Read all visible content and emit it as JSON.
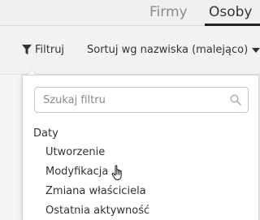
{
  "tabs": [
    {
      "label": "Firmy",
      "active": false
    },
    {
      "label": "Osoby",
      "active": true
    }
  ],
  "toolbar": {
    "filter_label": "Filtruj",
    "filter_icon": "funnel-icon",
    "sort_label": "Sortuj wg nazwiska (malejąco)",
    "sort_icon": "caret-down-icon"
  },
  "dropdown": {
    "search_placeholder": "Szukaj filtru",
    "search_value": "",
    "search_icon": "search-icon",
    "group": {
      "label": "Daty",
      "options": [
        "Utworzenie",
        "Modyfikacja",
        "Zmiana właściciela",
        "Ostatnia aktywność"
      ]
    }
  },
  "colors": {
    "background": "#f0f0f0",
    "panel": "#ffffff",
    "text": "#333333",
    "inactive_tab": "#8a8a8a",
    "active_underline": "#222222"
  }
}
